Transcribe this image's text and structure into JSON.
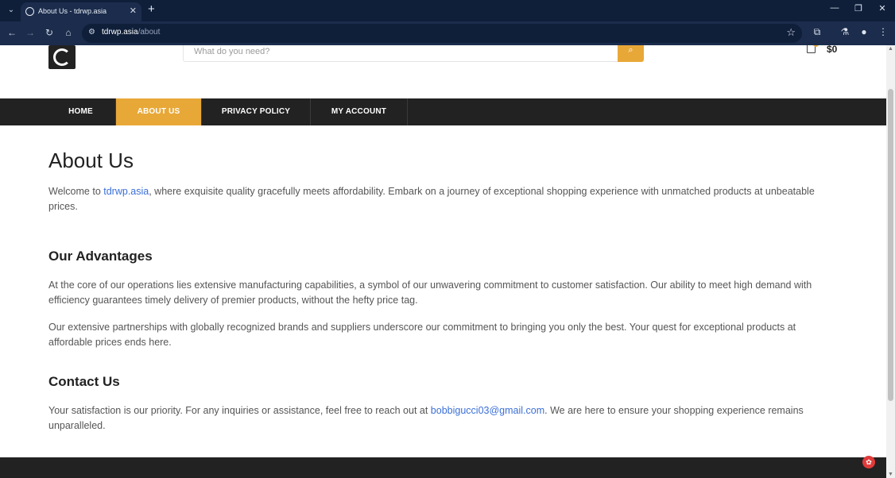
{
  "browser": {
    "tab_title": "About Us - tdrwp.asia",
    "url_host": "tdrwp.asia",
    "url_path": "/about"
  },
  "header": {
    "search_placeholder": "What do you need?",
    "cart_total": "$0"
  },
  "nav": {
    "items": [
      {
        "label": "HOME"
      },
      {
        "label": "ABOUT US",
        "active": true
      },
      {
        "label": "PRIVACY POLICY"
      },
      {
        "label": "MY ACCOUNT"
      }
    ]
  },
  "content": {
    "title": "About Us",
    "intro_prefix": "Welcome to ",
    "intro_link": "tdrwp.asia",
    "intro_suffix": ", where exquisite quality gracefully meets affordability. Embark on a journey of exceptional shopping experience with unmatched products at unbeatable prices.",
    "advantages_heading": "Our Advantages",
    "advantages_p1": "At the core of our operations lies extensive manufacturing capabilities, a symbol of our unwavering commitment to customer satisfaction. Our ability to meet high demand with efficiency guarantees timely delivery of premier products, without the hefty price tag.",
    "advantages_p2": "Our extensive partnerships with globally recognized brands and suppliers underscore our commitment to bringing you only the best. Your quest for exceptional products at affordable prices ends here.",
    "contact_heading": "Contact Us",
    "contact_prefix": "Your satisfaction is our priority. For any inquiries or assistance, feel free to reach out at ",
    "contact_email": "bobbigucci03@gmail.com",
    "contact_suffix": ". We are here to ensure your shopping experience remains unparalleled."
  },
  "colors": {
    "accent": "#e8a838",
    "nav_bg": "#222222",
    "link": "#3b6fd8"
  }
}
